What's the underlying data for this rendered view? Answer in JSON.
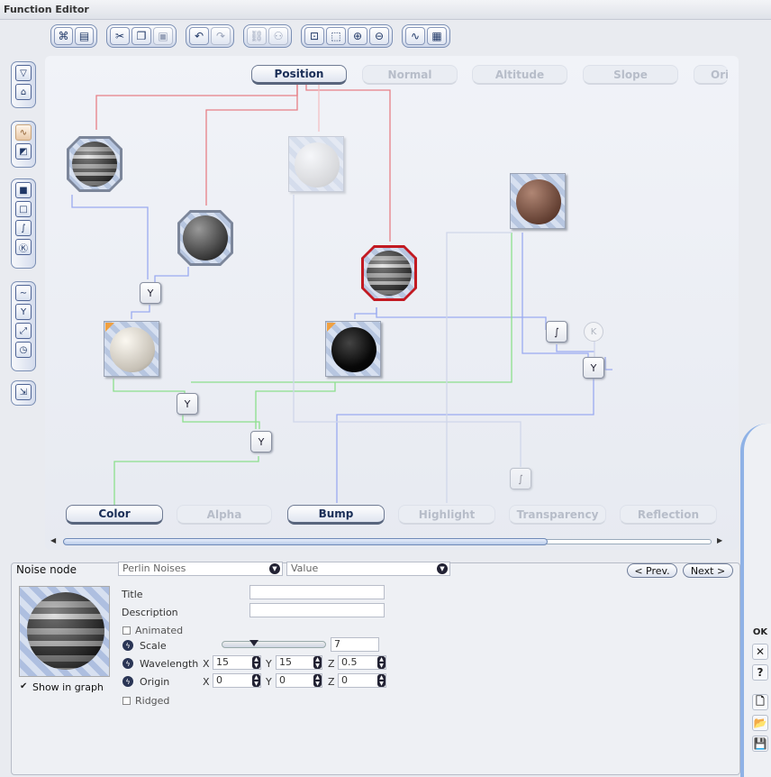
{
  "window": {
    "title": "Function Editor"
  },
  "toolbar": {
    "groups": [
      [
        "tree-icon",
        "panel-icon"
      ],
      [
        "cut-icon",
        "copy-icon",
        "paste-icon"
      ],
      [
        "undo-icon",
        "redo-icon"
      ],
      [
        "link-icon",
        "unlink-icon"
      ],
      [
        "zoom-fit-icon",
        "zoom-region-icon",
        "zoom-in-icon",
        "zoom-out-icon"
      ],
      [
        "wave-icon",
        "cube-icon"
      ]
    ]
  },
  "inputs": {
    "tabs": [
      {
        "label": "Position",
        "active": true
      },
      {
        "label": "Normal",
        "active": false
      },
      {
        "label": "Altitude",
        "active": false
      },
      {
        "label": "Slope",
        "active": false
      },
      {
        "label": "Ori",
        "active": false
      }
    ]
  },
  "outputs": {
    "tabs": [
      {
        "label": "Color",
        "active": true
      },
      {
        "label": "Alpha",
        "active": false
      },
      {
        "label": "Bump",
        "active": true
      },
      {
        "label": "Highlight",
        "active": false
      },
      {
        "label": "Transparency",
        "active": false
      },
      {
        "label": "Reflection",
        "active": false
      }
    ]
  },
  "graph": {
    "op_labels": {
      "combine": "Y",
      "curve": "∫",
      "constant": "K"
    }
  },
  "panel": {
    "section_label": "Noise node",
    "category": "Perlin Noises",
    "type": "Value",
    "prev_label": "< Prev.",
    "next_label": "Next >",
    "title_label": "Title",
    "title_value": "",
    "description_label": "Description",
    "description_value": "",
    "animated_label": "Animated",
    "scale_label": "Scale",
    "scale_value": "7",
    "wavelength_label": "Wavelength",
    "wavelength": {
      "x": "15",
      "y": "15",
      "z": "0.5"
    },
    "origin_label": "Origin",
    "origin": {
      "x": "0",
      "y": "0",
      "z": "0"
    },
    "ridged_label": "Ridged",
    "show_in_graph_label": "Show in graph",
    "axis": {
      "x": "X",
      "y": "Y",
      "z": "Z"
    }
  },
  "side_buttons": {
    "ok": "OK",
    "close": "✕",
    "help": "?"
  }
}
